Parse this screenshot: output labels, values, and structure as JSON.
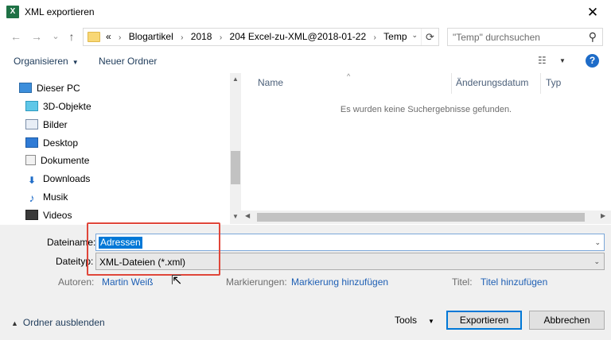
{
  "window": {
    "title": "XML exportieren",
    "app_icon": "X",
    "close_glyph": "✕"
  },
  "nav": {
    "back_glyph": "←",
    "forward_glyph": "→",
    "recent_glyph": "⌄",
    "up_glyph": "↑",
    "breadcrumb": [
      "«",
      "Blogartikel",
      "2018",
      "204 Excel-zu-XML@2018-01-22",
      "Temp"
    ],
    "separator": "›",
    "dropdown_glyph": "⌄",
    "refresh_glyph": "⟳",
    "search_placeholder": "\"Temp\" durchsuchen",
    "search_glyph": "⚲"
  },
  "toolbar": {
    "organize_label": "Organisieren",
    "new_folder_label": "Neuer Ordner",
    "caret_glyph": "▼",
    "view_glyph": "☷",
    "help_glyph": "?"
  },
  "tree": [
    {
      "label": "Dieser PC",
      "icon": "computer-icon"
    },
    {
      "label": "3D-Objekte",
      "icon": "cube-icon"
    },
    {
      "label": "Bilder",
      "icon": "pictures-icon"
    },
    {
      "label": "Desktop",
      "icon": "desktop-icon"
    },
    {
      "label": "Dokumente",
      "icon": "document-icon"
    },
    {
      "label": "Downloads",
      "icon": "download-icon",
      "glyph": "⬇"
    },
    {
      "label": "Musik",
      "icon": "music-icon",
      "glyph": "♪"
    },
    {
      "label": "Videos",
      "icon": "video-icon"
    }
  ],
  "scroll": {
    "up": "▲",
    "down": "▼",
    "left": "◀",
    "right": "▶",
    "sort": "^"
  },
  "list": {
    "columns": [
      "Name",
      "Änderungsdatum",
      "Typ"
    ],
    "empty_message": "Es wurden keine Suchergebnisse gefunden."
  },
  "form": {
    "filename_label": "Dateiname:",
    "filename_value": "Adressen",
    "filetype_label": "Dateityp:",
    "filetype_value": "XML-Dateien (*.xml)",
    "authors_label": "Autoren:",
    "authors_value": "Martin Weiß",
    "tags_label": "Markierungen:",
    "tags_value": "Markierung hinzufügen",
    "title_label": "Titel:",
    "title_value": "Titel hinzufügen"
  },
  "footer": {
    "hide_folders_label": "Ordner ausblenden",
    "hide_glyph": "▲",
    "tools_label": "Tools",
    "export_label": "Exportieren",
    "cancel_label": "Abbrechen"
  },
  "cursor_glyph": "⇱",
  "colors": {
    "accent": "#0078d7",
    "link": "#1e5fb4",
    "highlight_box": "#e0463a"
  }
}
